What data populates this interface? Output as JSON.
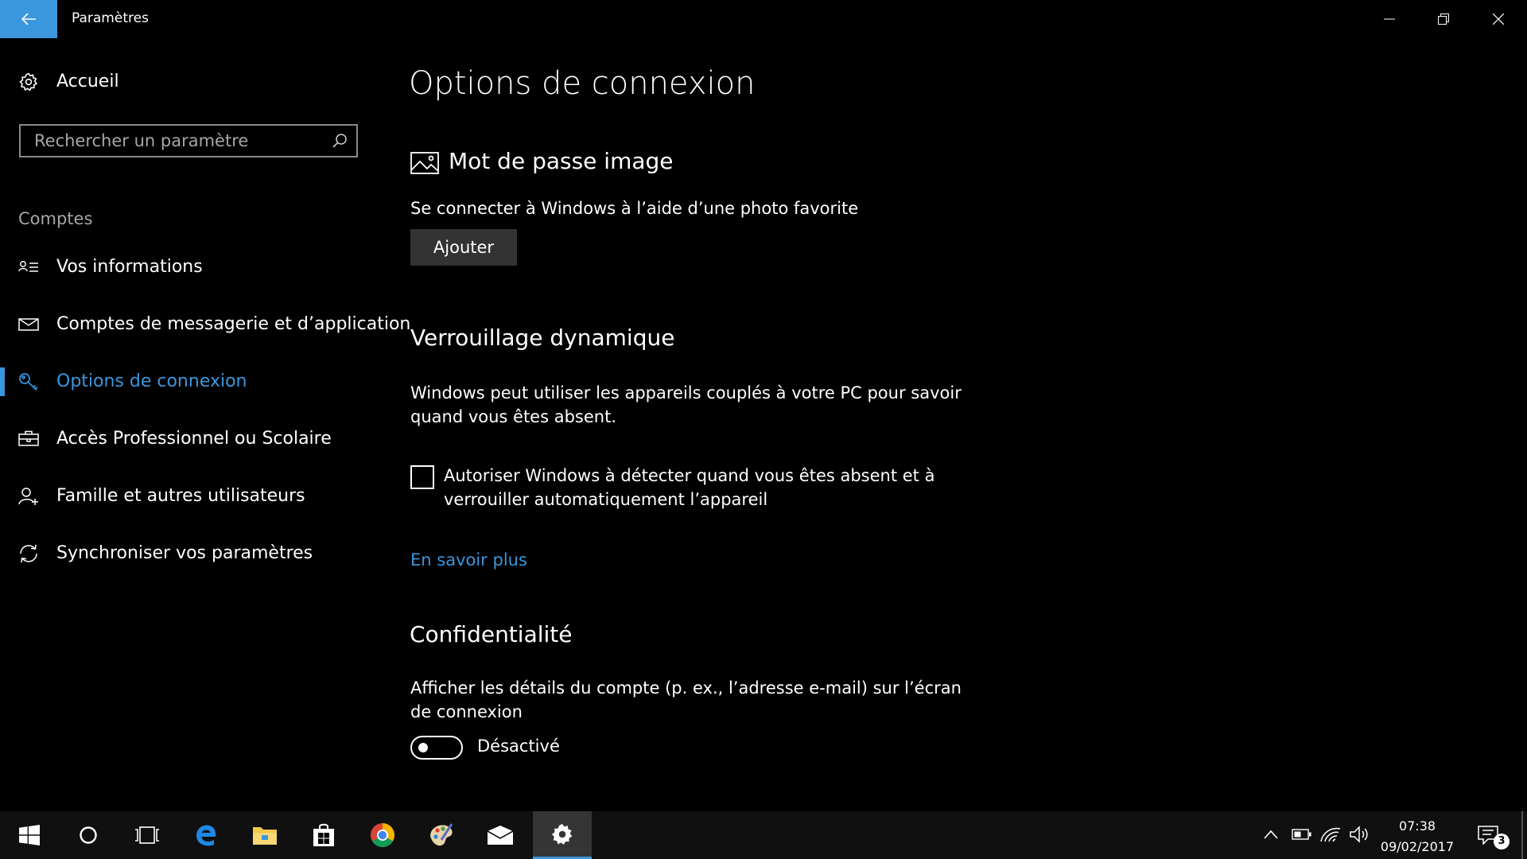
{
  "colors": {
    "accent": "#3a96dd",
    "background": "#000000",
    "taskbar": "#101010",
    "secondary_text": "#a6a6a6"
  },
  "window": {
    "title": "Paramètres",
    "back_icon": "back-arrow-icon",
    "controls": [
      "minimize-icon",
      "restore-icon",
      "close-icon"
    ]
  },
  "sidebar": {
    "home": {
      "label": "Accueil",
      "icon": "gear-icon"
    },
    "search": {
      "placeholder": "Rechercher un paramètre",
      "value": "",
      "icon": "search-icon"
    },
    "section_label": "Comptes",
    "items": [
      {
        "label": "Vos informations",
        "icon": "person-card-icon",
        "selected": false
      },
      {
        "label": "Comptes de messagerie et d’application",
        "icon": "mail-icon",
        "selected": false
      },
      {
        "label": "Options de connexion",
        "icon": "key-icon",
        "selected": true
      },
      {
        "label": "Accès Professionnel ou Scolaire",
        "icon": "briefcase-icon",
        "selected": false
      },
      {
        "label": "Famille et autres utilisateurs",
        "icon": "add-person-icon",
        "selected": false
      },
      {
        "label": "Synchroniser vos paramètres",
        "icon": "sync-icon",
        "selected": false
      }
    ]
  },
  "main": {
    "page_title": "Options de connexion",
    "picture_password": {
      "heading": "Mot de passe image",
      "icon": "picture-icon",
      "description": "Se connecter à Windows à l’aide d’une photo favorite",
      "button_label": "Ajouter"
    },
    "dynamic_lock": {
      "heading": "Verrouillage dynamique",
      "description_line1": "Windows peut utiliser les appareils couplés à votre PC pour savoir",
      "description_line2": "quand vous êtes absent.",
      "checkbox_line1": "Autoriser Windows à détecter quand vous êtes absent et à",
      "checkbox_line2": "verrouiller automatiquement l’appareil",
      "checkbox_checked": false,
      "link": "En savoir plus"
    },
    "privacy": {
      "heading": "Confidentialité",
      "description_line1": "Afficher les détails du compte (p. ex., l’adresse e-mail) sur l’écran",
      "description_line2": "de connexion",
      "toggle_on": false,
      "toggle_label": "Désactivé"
    }
  },
  "taskbar": {
    "apps": [
      "windows-start-icon",
      "cortana-icon",
      "task-view-icon",
      "edge-icon",
      "file-explorer-icon",
      "store-icon",
      "chrome-icon",
      "paint-icon",
      "mail-app-icon",
      "settings-icon"
    ],
    "active_app": "settings-icon",
    "tray_icons": [
      "chevron-up-icon",
      "battery-icon",
      "wifi-icon",
      "volume-icon"
    ],
    "time": "07:38",
    "date": "09/02/2017",
    "notification_count": "3"
  }
}
